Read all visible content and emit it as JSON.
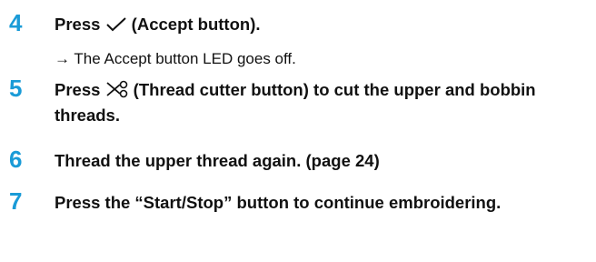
{
  "steps": [
    {
      "number": "4",
      "before_icon": "Press ",
      "icon": "checkmark-icon",
      "after_icon": " (Accept button).",
      "result_arrow": "→",
      "result_text": " The Accept button LED goes off."
    },
    {
      "number": "5",
      "before_icon": "Press ",
      "icon": "scissors-icon",
      "after_icon": " (Thread cutter button) to cut the upper and bobbin threads."
    },
    {
      "number": "6",
      "text": "Thread the upper thread again. (page 24)"
    },
    {
      "number": "7",
      "text": "Press the “Start/Stop” button to continue embroidering."
    }
  ],
  "colors": {
    "step_number": "#1a9bd7",
    "text": "#111111"
  }
}
